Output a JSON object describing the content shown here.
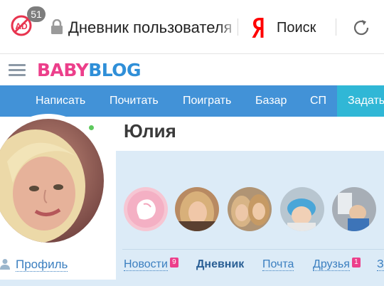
{
  "browser": {
    "ad_block_count": "51",
    "address_text": "Дневник пользователя",
    "search_label": "Поиск",
    "icons": [
      "ad-block-icon",
      "lock-icon",
      "yandex-icon",
      "reload-icon"
    ]
  },
  "site": {
    "logo_part1": "BABY",
    "logo_part2": "BLOG",
    "colors": {
      "brand_pink": "#ec3f8b",
      "brand_blue": "#2f8fd8",
      "nav_bg": "#4292d7",
      "ask_bg": "#30b7d6"
    }
  },
  "nav": {
    "items": [
      {
        "label": "Написать"
      },
      {
        "label": "Почитать"
      },
      {
        "label": "Поиграть"
      },
      {
        "label": "Базар"
      },
      {
        "label": "СП"
      }
    ],
    "ask_label": "Задать вопрос"
  },
  "profile": {
    "name": "Юлия",
    "online": true,
    "profile_link": "Профиль",
    "tabs": [
      {
        "label": "Новости",
        "badge": "9"
      },
      {
        "label": "Дневник",
        "badge": ""
      },
      {
        "label": "Почта",
        "badge": ""
      },
      {
        "label": "Друзья",
        "badge": "1"
      },
      {
        "label": "З",
        "badge": ""
      }
    ],
    "active_tab": "Дневник"
  }
}
